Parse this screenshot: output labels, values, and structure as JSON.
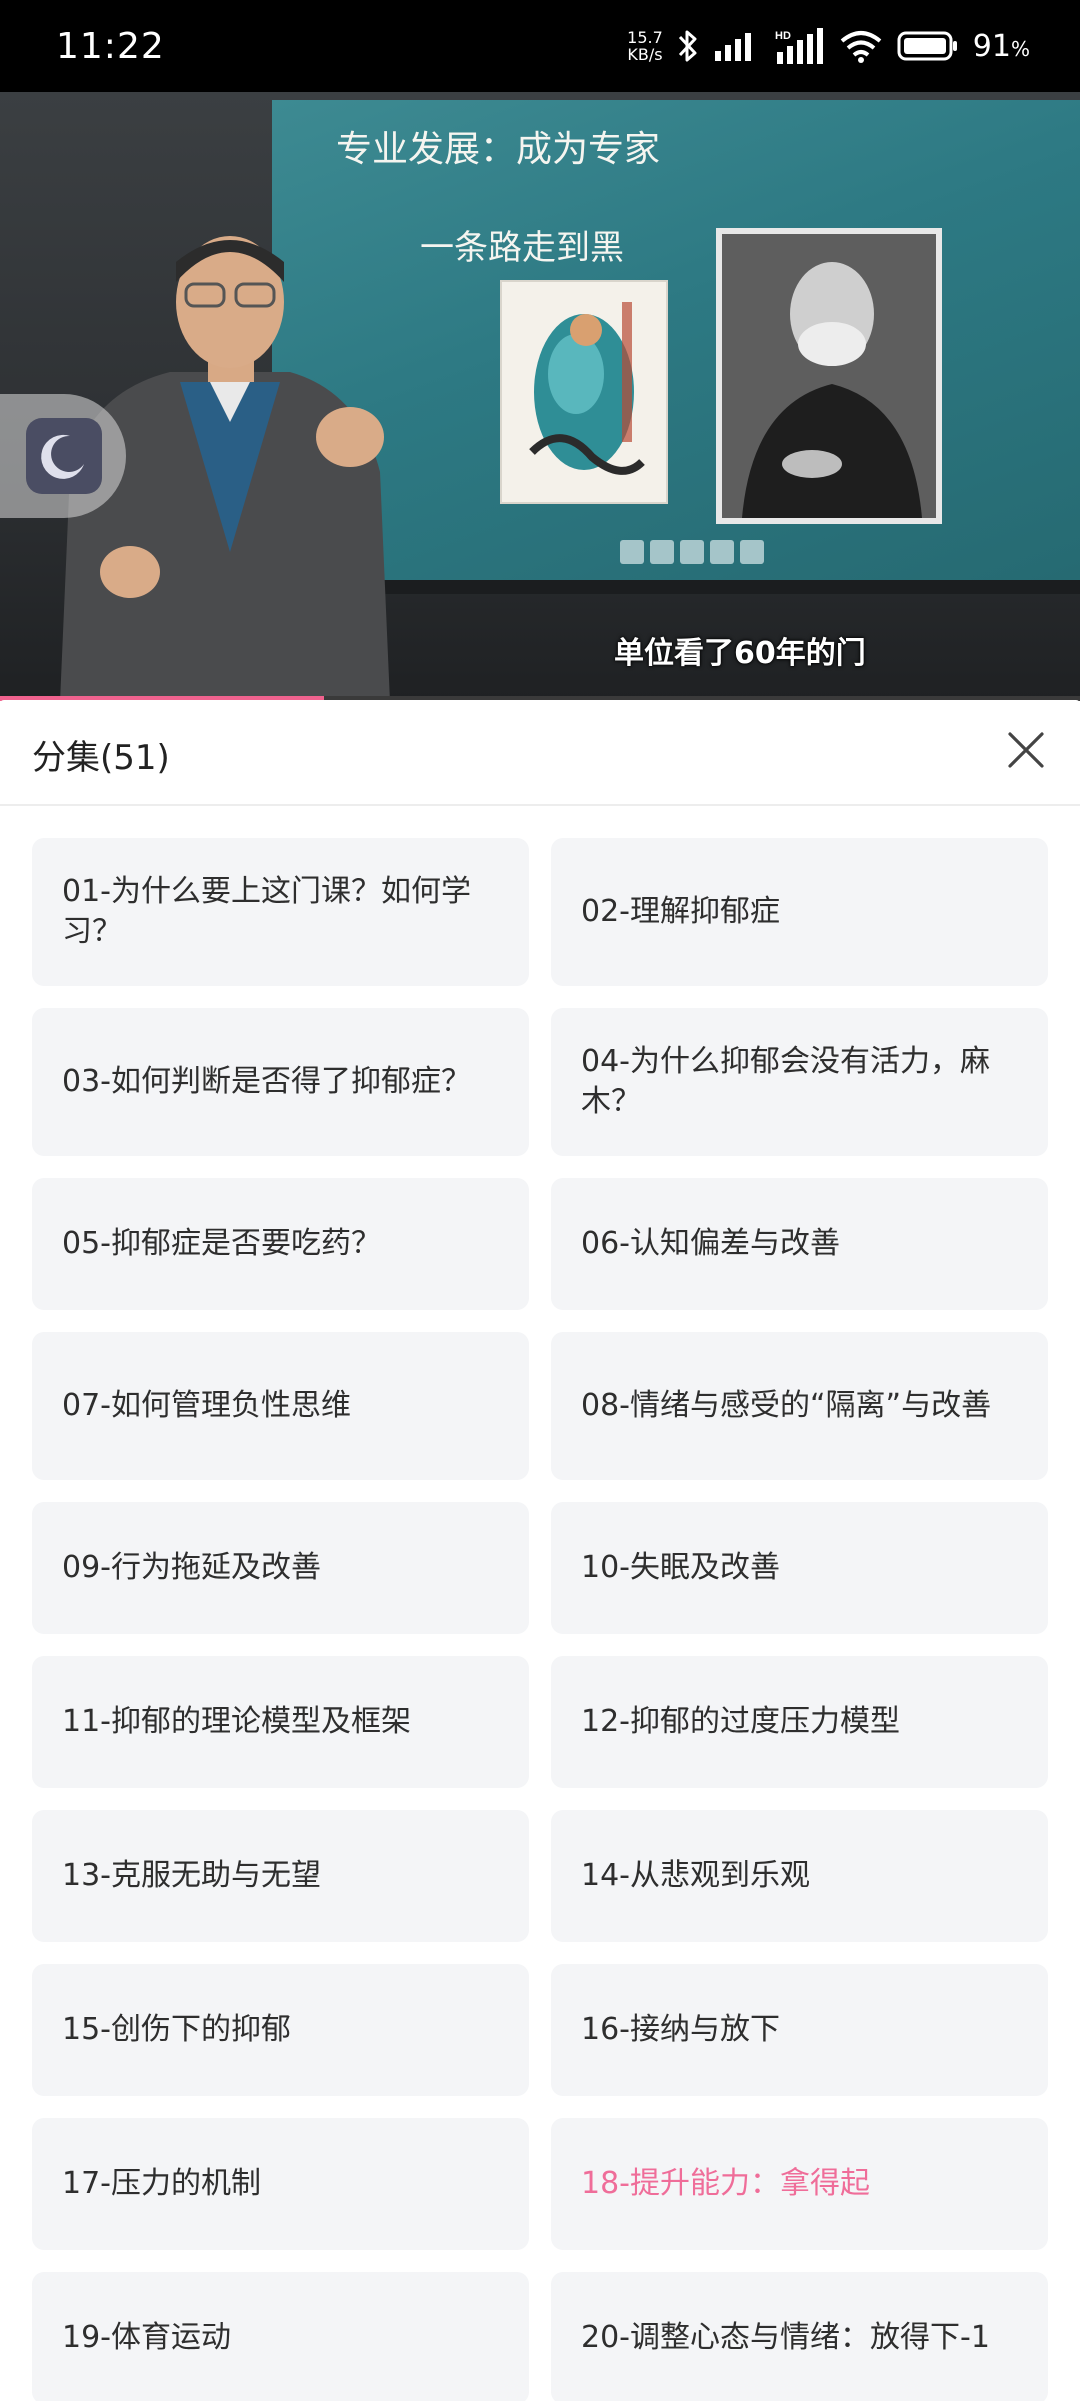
{
  "status_bar": {
    "time": "11:22",
    "net_speed_value": "15.7",
    "net_speed_unit": "KB/s",
    "battery_percent": "91",
    "battery_unit": "%"
  },
  "video": {
    "slide_title": "专业发展：成为专家",
    "slide_subtitle": "一条路走到黑",
    "caption": "单位看了60年的门",
    "progress": 0.3
  },
  "panel": {
    "title": "分集(51)",
    "episodes": [
      {
        "label": "01-为什么要上这门课？如何学习？"
      },
      {
        "label": "02-理解抑郁症"
      },
      {
        "label": "03-如何判断是否得了抑郁症？"
      },
      {
        "label": "04-为什么抑郁会没有活力，麻木？"
      },
      {
        "label": "05-抑郁症是否要吃药？"
      },
      {
        "label": "06-认知偏差与改善"
      },
      {
        "label": "07-如何管理负性思维"
      },
      {
        "label": "08-情绪与感受的“隔离”与改善"
      },
      {
        "label": "09-行为拖延及改善"
      },
      {
        "label": "10-失眠及改善"
      },
      {
        "label": "11-抑郁的理论模型及框架"
      },
      {
        "label": "12-抑郁的过度压力模型"
      },
      {
        "label": "13-克服无助与无望"
      },
      {
        "label": "14-从悲观到乐观"
      },
      {
        "label": "15-创伤下的抑郁"
      },
      {
        "label": "16-接纳与放下"
      },
      {
        "label": "17-压力的机制"
      },
      {
        "label": "18-提升能力：拿得起"
      },
      {
        "label": "19-体育运动"
      },
      {
        "label": "20-调整心态与情绪：放得下-1"
      }
    ],
    "active_episode_index": 17
  },
  "colors": {
    "accent": "#ef6d99",
    "card_bg": "#f4f5f7",
    "progress": "#f0628e"
  },
  "icons": {
    "sleep": "moon-icon",
    "close": "close-icon",
    "bluetooth": "bluetooth-icon",
    "wifi": "wifi-icon",
    "battery": "battery-icon"
  }
}
